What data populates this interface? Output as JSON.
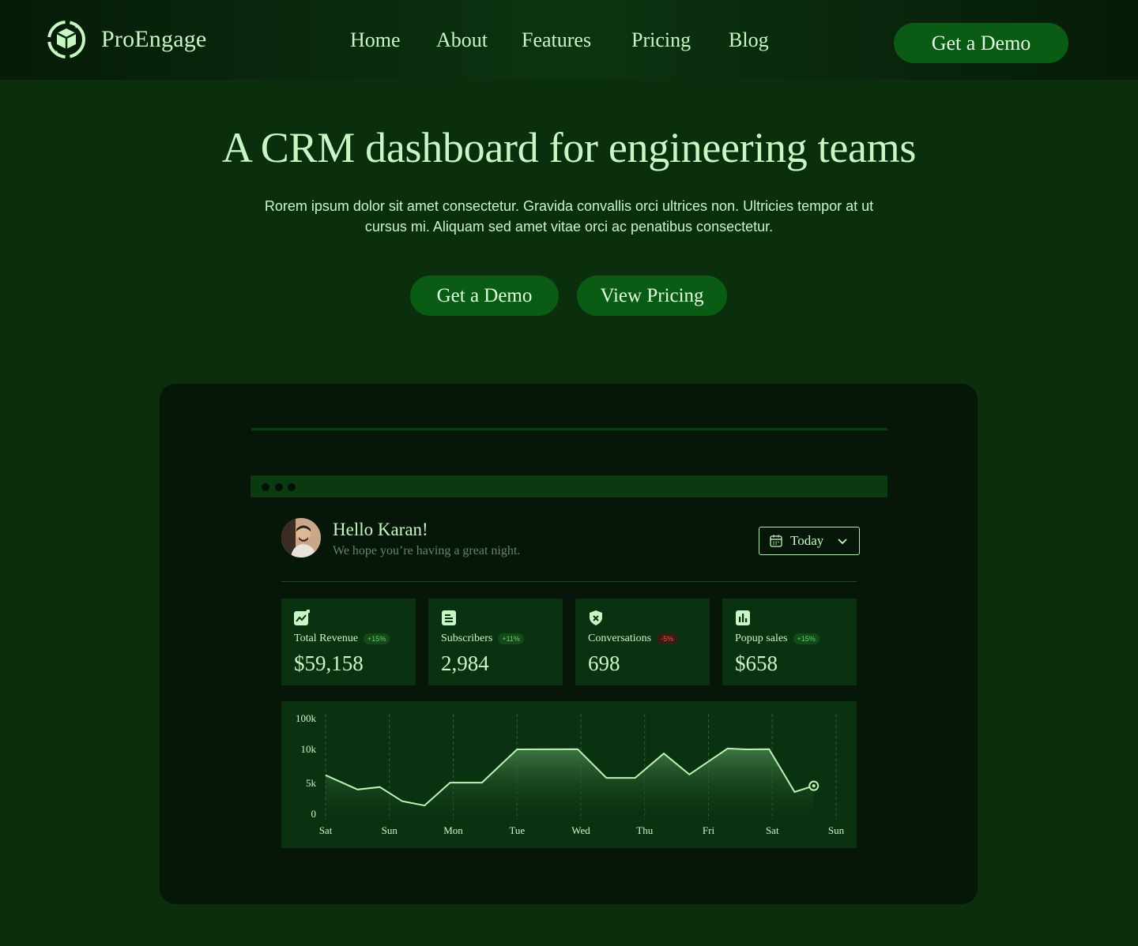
{
  "brand": {
    "name": "ProEngage"
  },
  "nav": {
    "links": [
      "Home",
      "About",
      "Features",
      "Pricing",
      "Blog"
    ],
    "cta": "Get a Demo"
  },
  "hero": {
    "title": "A CRM dashboard for engineering teams",
    "subtitle": "Rorem ipsum dolor sit amet consectetur. Gravida convallis orci ultrices non. Ultricies tempor at ut cursus mi. Aliquam sed amet vitae orci ac penatibus consectetur.",
    "primary_button": "Get a Demo",
    "secondary_button": "View Pricing"
  },
  "dashboard": {
    "greeting": "Hello Karan!",
    "greeting_sub": "We hope you’re having a great night.",
    "date_filter": "Today",
    "cards": [
      {
        "label": "Total Revenue",
        "badge": "+15%",
        "value": "$59,158",
        "icon": "trend-chart-icon",
        "negative": false
      },
      {
        "label": "Subscribers",
        "badge": "+11%",
        "value": "2,984",
        "icon": "document-icon",
        "negative": false
      },
      {
        "label": "Conversations",
        "badge": "-5%",
        "value": "698",
        "icon": "shield-icon",
        "negative": true
      },
      {
        "label": "Popup sales",
        "badge": "+15%",
        "value": "$658",
        "icon": "bar-chart-icon",
        "negative": false
      }
    ]
  },
  "colors": {
    "background": "#0b2f0d",
    "accent_text": "#c8f7c5",
    "button": "#0a5b14",
    "positive": "#63d36b",
    "negative": "#e05a4f"
  },
  "chart_data": {
    "type": "area",
    "y_ticks": [
      "100k",
      "10k",
      "5k",
      "0"
    ],
    "x_ticks": [
      "Sat",
      "Sun",
      "Mon",
      "Tue",
      "Wed",
      "Thu",
      "Fri",
      "Sat",
      "Sun"
    ],
    "series": [
      {
        "values": [
          {
            "x": 0.0,
            "y": 6200
          },
          {
            "x": 0.5,
            "y": 4000
          },
          {
            "x": 0.85,
            "y": 4400
          },
          {
            "x": 1.2,
            "y": 2100
          },
          {
            "x": 1.55,
            "y": 1400
          },
          {
            "x": 1.95,
            "y": 5100
          },
          {
            "x": 2.45,
            "y": 5100
          },
          {
            "x": 3.0,
            "y": 10000
          },
          {
            "x": 3.95,
            "y": 10600
          },
          {
            "x": 4.4,
            "y": 5800
          },
          {
            "x": 4.85,
            "y": 5800
          },
          {
            "x": 5.3,
            "y": 9400
          },
          {
            "x": 5.7,
            "y": 6300
          },
          {
            "x": 6.3,
            "y": 12500
          },
          {
            "x": 6.6,
            "y": 10000
          },
          {
            "x": 6.95,
            "y": 10600
          },
          {
            "x": 7.35,
            "y": 3600
          },
          {
            "x": 7.65,
            "y": 4600
          }
        ]
      }
    ],
    "grid": "vertical-dashed",
    "legend": "none"
  }
}
